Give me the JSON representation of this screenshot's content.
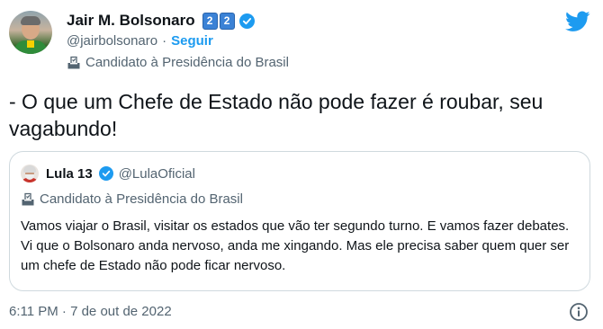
{
  "author": {
    "name": "Jair M. Bolsonaro",
    "badge_digits": [
      "2",
      "2"
    ],
    "handle": "@jairbolsonaro",
    "separator": "·",
    "follow_label": "Seguir",
    "label": "Candidato à Presidência do Brasil"
  },
  "tweet": {
    "text": "- O que um Chefe de Estado não pode fazer é roubar, seu vagabundo!",
    "timestamp": "6:11 PM · 7 de out de 2022"
  },
  "quoted": {
    "name": "Lula 13",
    "handle": "@LulaOficial",
    "label": "Candidato à Presidência do Brasil",
    "text": "Vamos viajar o Brasil, visitar os estados que vão ter segundo turno. E vamos fazer debates. Vi que o Bolsonaro anda nervoso, anda me xingando. Mas ele precisa saber quem quer ser um chefe de Estado não pode ficar nervoso."
  },
  "icons": {
    "brand": "twitter-bird-icon",
    "verified": "verified-badge-icon",
    "label": "ballot-box-icon",
    "info": "info-icon"
  },
  "colors": {
    "accent": "#1d9bf0",
    "secondary_text": "#536471",
    "border": "#cfd9de",
    "keycap": "#3b82d6"
  }
}
